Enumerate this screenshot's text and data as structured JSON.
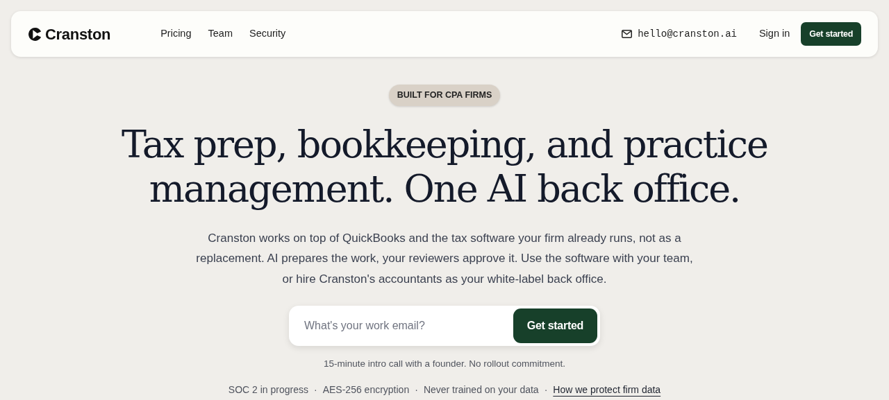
{
  "navbar": {
    "brand": "Cranston",
    "links": [
      "Pricing",
      "Team",
      "Security"
    ],
    "email": "hello@cranston.ai",
    "sign_in": "Sign in",
    "cta": "Get started"
  },
  "hero": {
    "eyebrow": "BUILT FOR CPA FIRMS",
    "headline": [
      "Tax prep, bookkeeping, and practice",
      "management. One AI back office."
    ],
    "lede": [
      "Cranston works on top of QuickBooks and the tax software your firm already runs, not as a",
      "replacement. AI prepares the work, your reviewers approve it. Use the software with your team,",
      "or hire Cranston's accountants as your white-label back office."
    ],
    "form": {
      "placeholder": "What's your work email?",
      "button": "Get started"
    },
    "note": "15-minute intro call with a founder. No rollout commitment.",
    "trust": {
      "separator": "·",
      "items": [
        {
          "text": "SOC 2 in progress",
          "kind": "plain"
        },
        {
          "text": "AES-256 encryption",
          "kind": "plain"
        },
        {
          "text": "Never trained on your data",
          "kind": "plain"
        },
        {
          "text": "How we protect firm data",
          "kind": "link"
        }
      ]
    }
  }
}
